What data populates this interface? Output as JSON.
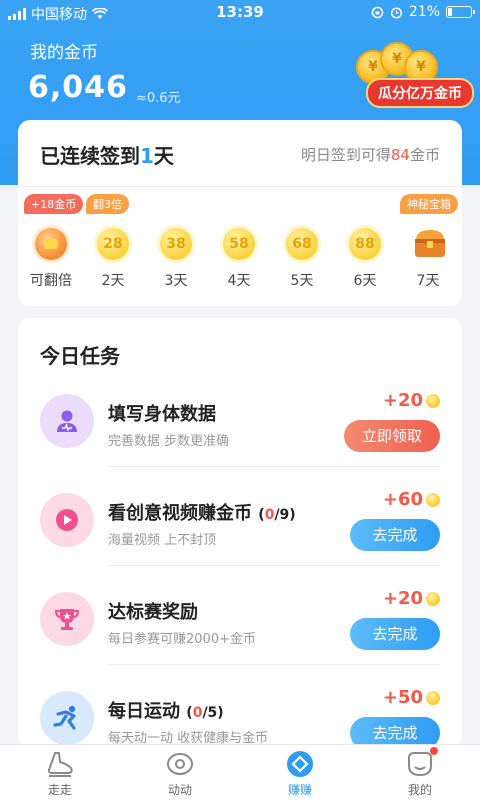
{
  "status_bar": {
    "carrier": "中国移动",
    "time": "13:39",
    "battery": "21%",
    "battery_level": 0.21
  },
  "header": {
    "coins_label": "我的金币",
    "coins_value": "6,046",
    "coins_approx": "≈0.6元",
    "promo_label": "瓜分亿万金币",
    "coin_symbol": "¥"
  },
  "checkin": {
    "title_prefix": "已连续签到",
    "days": "1",
    "title_suffix": "天",
    "tip_prefix": "明日签到可得",
    "tip_amount": "84",
    "tip_suffix": "金币",
    "items": [
      {
        "tag": "+18金币",
        "value": "",
        "label": "可翻倍"
      },
      {
        "tag": "翻3倍",
        "value": "28",
        "label": "2天"
      },
      {
        "tag": "",
        "value": "38",
        "label": "3天"
      },
      {
        "tag": "",
        "value": "58",
        "label": "4天"
      },
      {
        "tag": "",
        "value": "68",
        "label": "5天"
      },
      {
        "tag": "",
        "value": "88",
        "label": "6天"
      },
      {
        "tag": "神秘宝箱",
        "value": "",
        "label": "7天"
      }
    ]
  },
  "tasks": {
    "title": "今日任务",
    "items": [
      {
        "title": "填写身体数据",
        "progress_done": "",
        "progress_total": "",
        "subtitle": "完善数据 步数更准确",
        "reward": "+20",
        "button": "立即领取"
      },
      {
        "title": "看创意视频赚金币",
        "progress_done": "0",
        "progress_total": "/9)",
        "subtitle": "海量视频 上不封顶",
        "reward": "+60",
        "button": "去完成"
      },
      {
        "title": "达标赛奖励",
        "progress_done": "",
        "progress_total": "",
        "subtitle": "每日参赛可赚2000+金币",
        "reward": "+20",
        "button": "去完成"
      },
      {
        "title": "每日运动",
        "progress_done": "0",
        "progress_total": "/5)",
        "subtitle": "每天动一动 收获健康与金币",
        "reward": "+50",
        "button": "去完成"
      }
    ]
  },
  "tabbar": {
    "items": [
      {
        "label": "走走",
        "icon": "shoe-icon"
      },
      {
        "label": "动动",
        "icon": "eye-icon"
      },
      {
        "label": "赚赚",
        "icon": "diamond-icon"
      },
      {
        "label": "我的",
        "icon": "face-icon"
      }
    ],
    "active_index": 2
  },
  "colors": {
    "brand_blue": "#2f9cf3",
    "accent_red": "#f25a4a",
    "coin_gold": "#fcd23b"
  }
}
